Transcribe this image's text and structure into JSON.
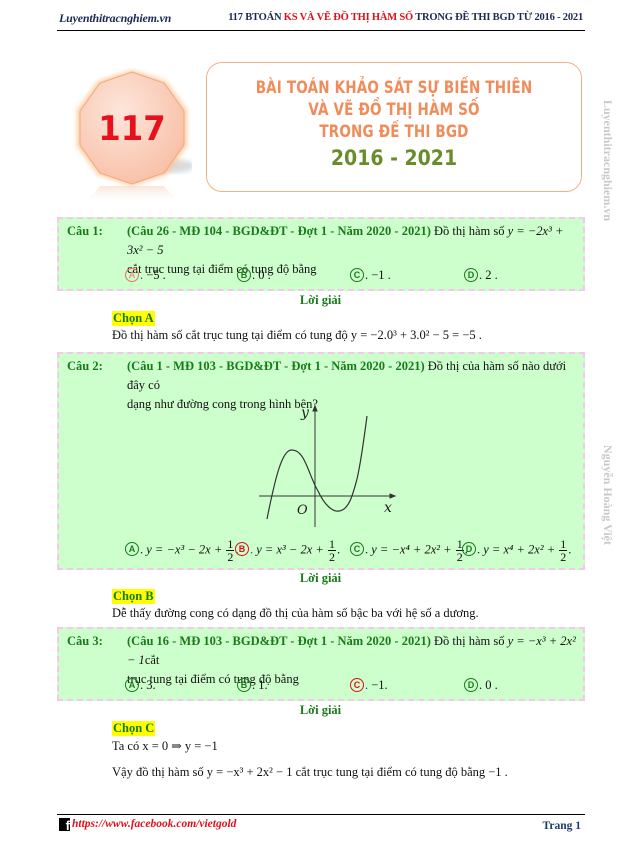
{
  "header": {
    "site": "Luyenthitracnghiem.vn",
    "title_parts": [
      {
        "text": "117 BTOÁN ",
        "color": "dark"
      },
      {
        "text": "KS VÀ VẼ ĐỒ THỊ HÀM SỐ",
        "color": "red"
      },
      {
        "text": " TRONG ĐỀ THI BGD TỪ 2016 - 2021",
        "color": "dark"
      }
    ]
  },
  "banner": {
    "badge_number": "117",
    "title_lines": [
      "BÀI TOÁN KHẢO SÁT SỰ BIẾN THIÊN",
      "VÀ VẼ ĐỒ THỊ HÀM SỐ",
      "TRONG ĐỀ THI BGD"
    ],
    "years": "2016 - 2021"
  },
  "watermarks": {
    "site": "Luyenthitracnghiem.vn",
    "author": "Nguyễn Hoàng Việt"
  },
  "questions": [
    {
      "label": "Câu 1:",
      "source": "(Câu 26 - MĐ 104 - BGD&ĐT - Đợt 1 - Năm 2020 - 2021)",
      "text_before": " Đồ thị hàm số ",
      "formula": "y = −2x³ + 3x² − 5",
      "text_after": "cắt trục tung tại điểm có tung độ bằng",
      "options": [
        {
          "letter": "A",
          "value": "−5 ."
        },
        {
          "letter": "B",
          "value": "0 ."
        },
        {
          "letter": "C",
          "value": "−1 ."
        },
        {
          "letter": "D",
          "value": "2 ."
        }
      ],
      "solution_heading": "Lời giải",
      "answer": "Chọn A",
      "solution_lines": [
        "Đồ thị hàm số cắt trục tung tại điểm có tung độ  y = −2.0³ + 3.0² − 5 = −5 ."
      ]
    },
    {
      "label": "Câu 2:",
      "source": "(Câu 1 - MĐ 103 - BGD&ĐT - Đợt 1 - Năm 2020 - 2021)",
      "text_before": " Đồ thị của hàm số nào dưới đây có",
      "text_after": "dạng như đường cong trong hình bên?",
      "figure": {
        "x_label": "x",
        "y_label": "y",
        "origin_label": "O"
      },
      "options": [
        {
          "letter": "A",
          "prefix": "y = −x³ − 2x + ",
          "num": "1",
          "den": "2"
        },
        {
          "letter": "B",
          "prefix": "y = x³ − 2x + ",
          "num": "1",
          "den": "2"
        },
        {
          "letter": "C",
          "prefix": "y = −x⁴ + 2x² + ",
          "num": "1",
          "den": "2"
        },
        {
          "letter": "D",
          "prefix": "y = x⁴ + 2x² + ",
          "num": "1",
          "den": "2"
        }
      ],
      "solution_heading": "Lời giải",
      "answer": "Chọn B",
      "solution_lines": [
        "Dễ thấy đường cong có dạng đồ thị của hàm số bậc ba với hệ số  a  dương."
      ]
    },
    {
      "label": "Câu 3:",
      "source": "(Câu 16 - MĐ 103 - BGD&ĐT - Đợt 1 - Năm 2020 - 2021)",
      "text_before": " Đồ thị hàm số ",
      "formula": "y = −x³ + 2x² − 1",
      "text_after_inline": "cắt",
      "text_after": "trục tung tại điểm có tung độ bằng",
      "options": [
        {
          "letter": "A",
          "value": "3."
        },
        {
          "letter": "B",
          "value": "1."
        },
        {
          "letter": "C",
          "value": "−1."
        },
        {
          "letter": "D",
          "value": "0 ."
        }
      ],
      "solution_heading": "Lời giải",
      "answer": "Chọn C",
      "solution_lines": [
        "Ta có  x = 0 ⇒ y = −1",
        "Vậy đồ thị hàm số  y = −x³ + 2x² − 1 cắt trục tung tại điểm có tung độ bằng  −1 ."
      ]
    }
  ],
  "footer": {
    "fb_glyph": "f",
    "url": "https://www.facebook.com/vietgold",
    "page": "Trang 1"
  },
  "colors": {
    "question_bg": "#ccffcc",
    "question_border": "#f6c6ef",
    "green_text": "#1a7a1a",
    "highlight": "#ffff00",
    "red": "#e0101a",
    "title_orange": "#f08c5a",
    "year_green": "#6a8c2a"
  }
}
